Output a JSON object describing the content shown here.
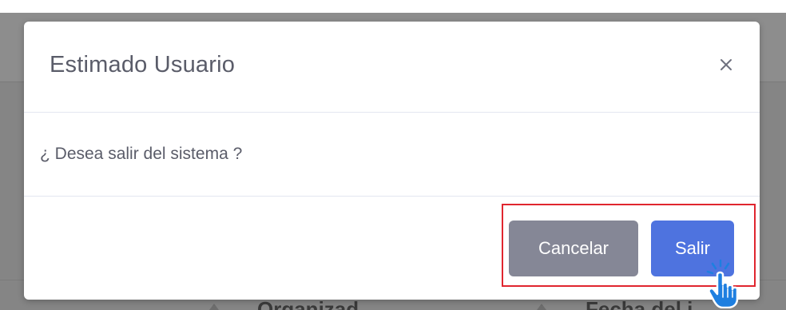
{
  "modal": {
    "title": "Estimado Usuario",
    "close_label": "×",
    "message": "¿ Desea salir del sistema ?",
    "buttons": {
      "cancel_label": "Cancelar",
      "exit_label": "Salir"
    }
  },
  "backdrop": {
    "column_1": "Organizad",
    "column_2": "Fecha del i"
  },
  "colors": {
    "cancel_button": "#858796",
    "exit_button": "#4e73df",
    "highlight_border": "#e0262f",
    "cursor": "#1e7fe0"
  },
  "icons": {
    "close": "close-icon",
    "cursor": "hand-pointer-icon"
  }
}
